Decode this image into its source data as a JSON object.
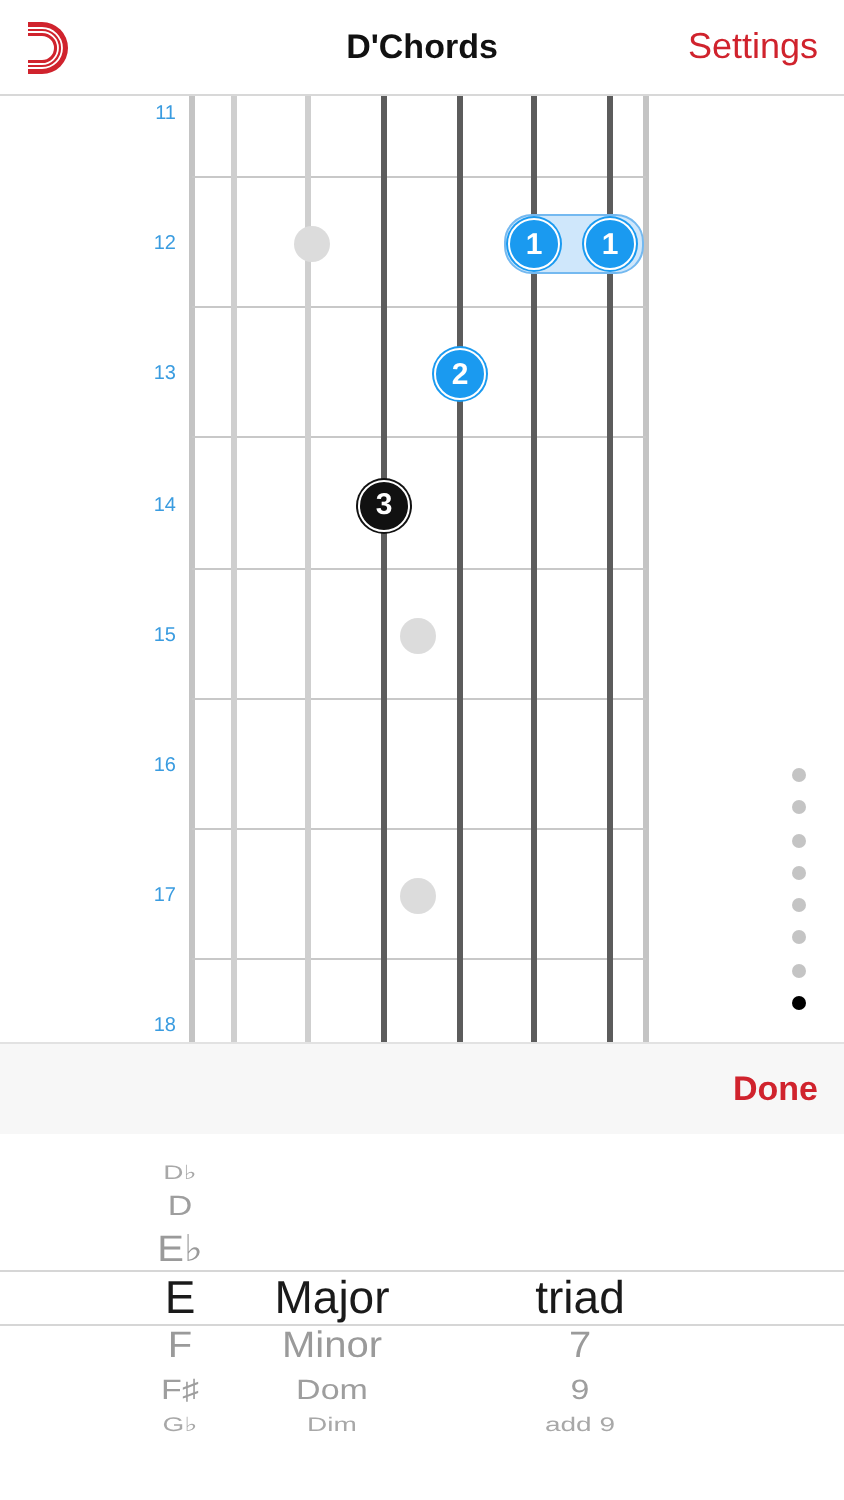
{
  "nav_bar": {
    "title": "D'Chords",
    "settings_button": "Settings"
  },
  "fretboard": {
    "strings": [
      {
        "played": false
      },
      {
        "played": false
      },
      {
        "played": true
      },
      {
        "played": true
      },
      {
        "played": true
      },
      {
        "played": true
      }
    ],
    "frets": [
      {
        "label": "11",
        "kind": "plain",
        "positions": [
          {
            "kind": "empty"
          },
          {
            "kind": "empty"
          },
          {
            "kind": "empty"
          },
          {
            "kind": "empty"
          },
          {
            "kind": "empty"
          },
          {
            "kind": "empty"
          }
        ]
      },
      {
        "label": "12",
        "kind": "double-inlay",
        "positions": [
          {
            "kind": "empty"
          },
          {
            "kind": "empty"
          },
          {
            "kind": "empty"
          },
          {
            "kind": "empty"
          },
          {
            "kind": "barre",
            "label": "1"
          },
          {
            "kind": "barre",
            "label": "1"
          }
        ]
      },
      {
        "label": "13",
        "kind": "plain",
        "positions": [
          {
            "kind": "empty"
          },
          {
            "kind": "empty"
          },
          {
            "kind": "empty"
          },
          {
            "kind": "finger",
            "label": "2"
          },
          {
            "kind": "empty"
          },
          {
            "kind": "empty"
          }
        ]
      },
      {
        "label": "14",
        "kind": "plain",
        "positions": [
          {
            "kind": "empty"
          },
          {
            "kind": "empty"
          },
          {
            "kind": "root",
            "label": "3"
          },
          {
            "kind": "empty"
          },
          {
            "kind": "empty"
          },
          {
            "kind": "empty"
          }
        ]
      },
      {
        "label": "15",
        "kind": "single-inlay",
        "positions": [
          {
            "kind": "empty"
          },
          {
            "kind": "empty"
          },
          {
            "kind": "empty"
          },
          {
            "kind": "empty"
          },
          {
            "kind": "empty"
          },
          {
            "kind": "empty"
          }
        ]
      },
      {
        "label": "16",
        "kind": "plain",
        "positions": [
          {
            "kind": "empty"
          },
          {
            "kind": "empty"
          },
          {
            "kind": "empty"
          },
          {
            "kind": "empty"
          },
          {
            "kind": "empty"
          },
          {
            "kind": "empty"
          }
        ]
      },
      {
        "label": "17",
        "kind": "single-inlay",
        "positions": [
          {
            "kind": "empty"
          },
          {
            "kind": "empty"
          },
          {
            "kind": "empty"
          },
          {
            "kind": "empty"
          },
          {
            "kind": "empty"
          },
          {
            "kind": "empty"
          }
        ]
      },
      {
        "label": "18",
        "kind": "plain",
        "positions": [
          {
            "kind": "empty"
          },
          {
            "kind": "empty"
          },
          {
            "kind": "empty"
          },
          {
            "kind": "empty"
          },
          {
            "kind": "empty"
          },
          {
            "kind": "empty"
          }
        ]
      }
    ],
    "pages": [
      {
        "selected": false
      },
      {
        "selected": false
      },
      {
        "selected": false
      },
      {
        "selected": false
      },
      {
        "selected": false
      },
      {
        "selected": false
      },
      {
        "selected": false
      },
      {
        "selected": true
      }
    ]
  },
  "toolbar": {
    "done_button": "Done"
  },
  "picker": {
    "columns": [
      {
        "items": [
          {
            "label": "D♭",
            "selected": false
          },
          {
            "label": "D",
            "selected": false
          },
          {
            "label": "E♭",
            "selected": false
          },
          {
            "label": "E",
            "selected": true
          },
          {
            "label": "F",
            "selected": false
          },
          {
            "label": "F♯",
            "selected": false
          },
          {
            "label": "G♭",
            "selected": false
          }
        ]
      },
      {
        "items": [
          {
            "label": "Major",
            "selected": true
          },
          {
            "label": "Minor",
            "selected": false
          },
          {
            "label": "Dom",
            "selected": false
          },
          {
            "label": "Dim",
            "selected": false
          }
        ]
      },
      {
        "items": [
          {
            "label": "triad",
            "selected": true
          },
          {
            "label": "7",
            "selected": false
          },
          {
            "label": "9",
            "selected": false
          },
          {
            "label": "add 9",
            "selected": false
          }
        ]
      }
    ]
  }
}
